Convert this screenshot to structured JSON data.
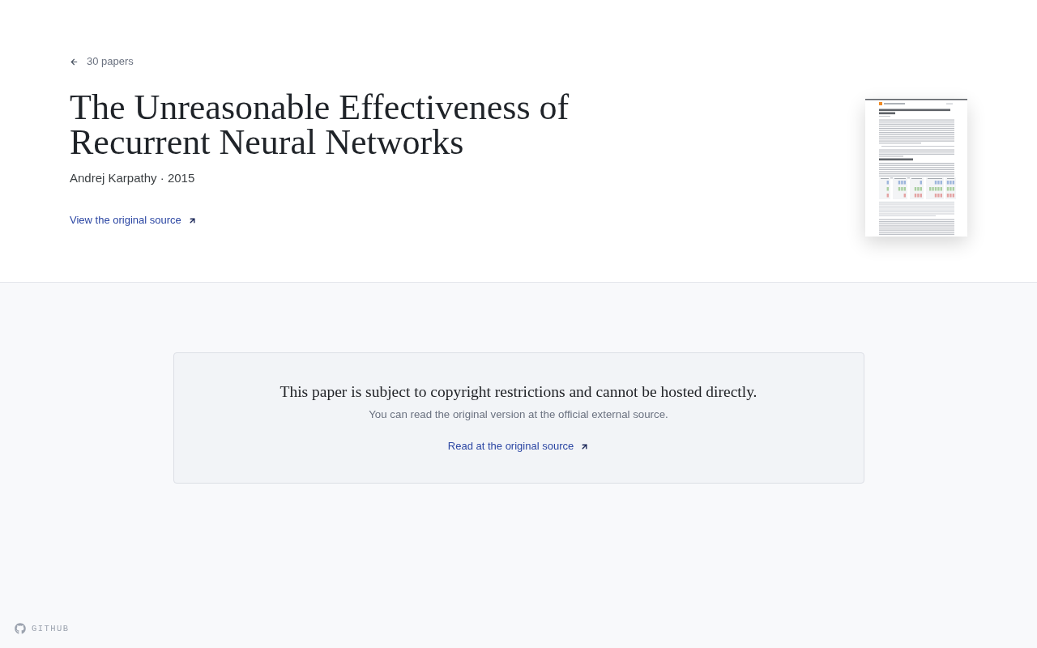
{
  "back_link": {
    "label": "30 papers"
  },
  "paper": {
    "title": "The Unreasonable Effectiveness of Recurrent Neural Networks",
    "byline": "Andrej Karpathy · 2015",
    "source_link": "View the original source"
  },
  "notice": {
    "heading": "This paper is subject to copyright restrictions and cannot be hosted directly.",
    "text": "You can read the original version at the official external source.",
    "link": "Read at the original source"
  },
  "footer": {
    "link": "GITHUB"
  }
}
